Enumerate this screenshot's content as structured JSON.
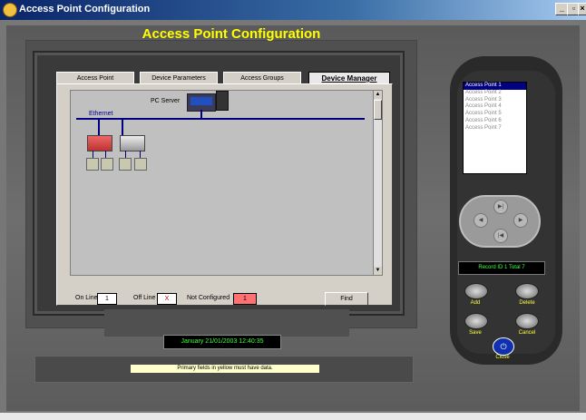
{
  "window": {
    "title": "Access Point Configuration",
    "min": "_",
    "max": "▫",
    "close": "×"
  },
  "header": {
    "title": "Access Point Configuration"
  },
  "tabs": [
    {
      "label": "Access Point"
    },
    {
      "label": "Device Parameters"
    },
    {
      "label": "Access Groups"
    },
    {
      "label": "Device Manager"
    }
  ],
  "network": {
    "server_label": "PC Server",
    "ethernet_label": "Ethernet"
  },
  "status": {
    "online_label": "On Line",
    "online_value": "1",
    "offline_label": "Off Line",
    "offline_value": "X",
    "notconfig_label": "Not Configured",
    "notconfig_value": "1",
    "find_label": "Find"
  },
  "clock": "January  21/01/2003 12:40:35",
  "message": "Primary fields in yellow must have data.",
  "access_points": [
    "Access Point 1",
    "Access Point 2",
    "Access Point 3",
    "Access Point 4",
    "Access Point 5",
    "Access Point 6",
    "Access Point 7"
  ],
  "record": "Record ID 1 Total 7",
  "buttons": {
    "add": "Add",
    "delete": "Delete",
    "save": "Save",
    "cancel": "Cancel",
    "close": "Close"
  },
  "nav": {
    "up": "▶|",
    "left": "◀",
    "right": "▶",
    "down": "|◀"
  },
  "colors": {
    "accent_yellow": "#ffff00",
    "led_green": "#40ff40",
    "select_blue": "#000080"
  }
}
